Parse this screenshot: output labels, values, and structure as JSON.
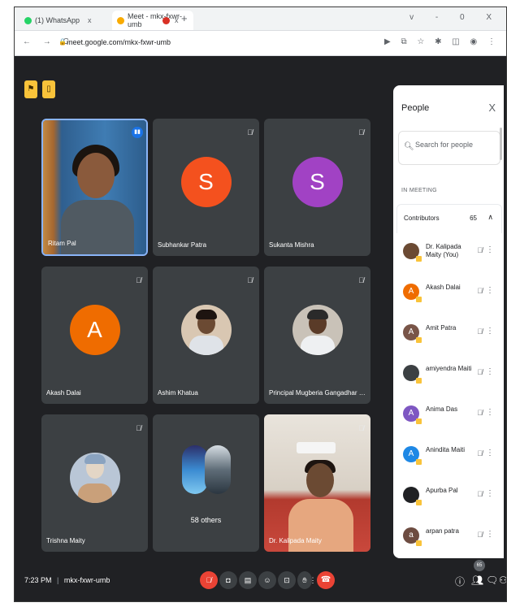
{
  "browser": {
    "tabs": [
      {
        "label": "(1) WhatsApp",
        "color": "#25d366"
      },
      {
        "label": "Meet - mkx-fxwr-umb",
        "color": "#f9ab00"
      },
      {
        "label": "",
        "color": "#d93025"
      }
    ],
    "new_tab": "+",
    "window_controls": "v - 0 X",
    "nav": "← → C",
    "url": "meet.google.com/mkx-fxwr-umb",
    "url_right_icons": "▶ ⧉ ☆ ✱ ◫ ◉ ⋮"
  },
  "meet": {
    "tiles": [
      {
        "name": "Ritam Pal",
        "type": "camera"
      },
      {
        "name": "Subhankar Patra",
        "type": "letter",
        "letter": "S",
        "color": "#f4511e"
      },
      {
        "name": "Sukanta Mishra",
        "type": "letter",
        "letter": "S",
        "color": "#a142c4"
      },
      {
        "name": "Akash Dalai",
        "type": "letter",
        "letter": "A",
        "color": "#ef6c00"
      },
      {
        "name": "Ashim Khatua",
        "type": "photo"
      },
      {
        "name": "Principal Mugberia Gangadhar Mahavidyala...",
        "type": "photo"
      },
      {
        "name": "Trishna Maity",
        "type": "photo"
      },
      {
        "name": "58 others",
        "type": "others"
      },
      {
        "name": "Dr. Kalipada Maity",
        "type": "camera"
      }
    ],
    "others_label": "58 others"
  },
  "people_panel": {
    "title": "People",
    "close": "X",
    "search_placeholder": "Search for people",
    "section": "IN MEETING",
    "contributors_label": "Contributors",
    "contributors_count": "65",
    "people": [
      {
        "name": "Dr. Kalipada Maity (You)",
        "initial": "",
        "color": "#6b4a33"
      },
      {
        "name": "Akash Dalai",
        "initial": "A",
        "color": "#ef6c00"
      },
      {
        "name": "Amit Patra",
        "initial": "A",
        "color": "#795548"
      },
      {
        "name": "amiyendra Maiti",
        "initial": "",
        "color": "#3c4043"
      },
      {
        "name": "Anima Das",
        "initial": "A",
        "color": "#7e57c2"
      },
      {
        "name": "Anindita Maiti",
        "initial": "A",
        "color": "#1e88e5"
      },
      {
        "name": "Apurba Pal",
        "initial": "",
        "color": "#202124"
      },
      {
        "name": "arpan patra",
        "initial": "a",
        "color": "#6d4c41"
      }
    ]
  },
  "bottom_bar": {
    "time": "7:23 PM",
    "separator": "|",
    "meeting_code": "mkx-fxwr-umb",
    "participant_badge": "65"
  },
  "colors": {
    "meet_bg": "#202124",
    "tile_bg": "#3c4043",
    "highlight": "#f9c33a",
    "end_call": "#ea4335"
  }
}
